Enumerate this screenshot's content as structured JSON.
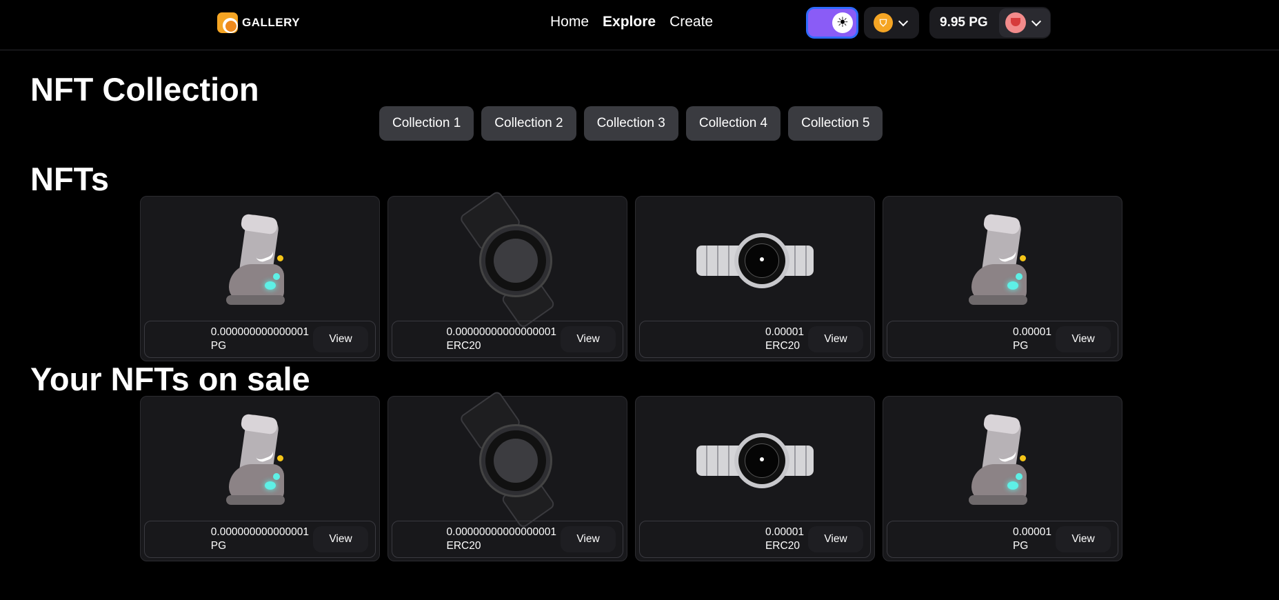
{
  "header": {
    "logo_text": "GALLERY",
    "nav": [
      {
        "label": "Home",
        "active": false
      },
      {
        "label": "Explore",
        "active": true
      },
      {
        "label": "Create",
        "active": false
      }
    ],
    "balance": "9.95 PG",
    "theme_icon": "sun-icon",
    "chain_icon": "shield-icon",
    "accent_color": "#8a5cf6"
  },
  "page": {
    "title": "NFT Collection",
    "collections": [
      "Collection 1",
      "Collection 2",
      "Collection 3",
      "Collection 4",
      "Collection 5"
    ],
    "nfts_heading": "NFTs",
    "sale_heading": "Your NFTs on sale"
  },
  "nfts": [
    {
      "image": "sneaker",
      "price": "0.000000000000001",
      "currency": "PG",
      "view_label": "View"
    },
    {
      "image": "black-watch",
      "price": "0.00000000000000001",
      "currency": "ERC20",
      "view_label": "View"
    },
    {
      "image": "silver-watch",
      "price": "0.00001",
      "currency": "ERC20",
      "view_label": "View"
    },
    {
      "image": "sneaker",
      "price": "0.00001",
      "currency": "PG",
      "view_label": "View"
    }
  ],
  "on_sale": [
    {
      "image": "sneaker",
      "price": "0.000000000000001",
      "currency": "PG",
      "view_label": "View"
    },
    {
      "image": "black-watch",
      "price": "0.00000000000000001",
      "currency": "ERC20",
      "view_label": "View"
    },
    {
      "image": "silver-watch",
      "price": "0.00001",
      "currency": "ERC20",
      "view_label": "View"
    },
    {
      "image": "sneaker",
      "price": "0.00001",
      "currency": "PG",
      "view_label": "View"
    }
  ]
}
